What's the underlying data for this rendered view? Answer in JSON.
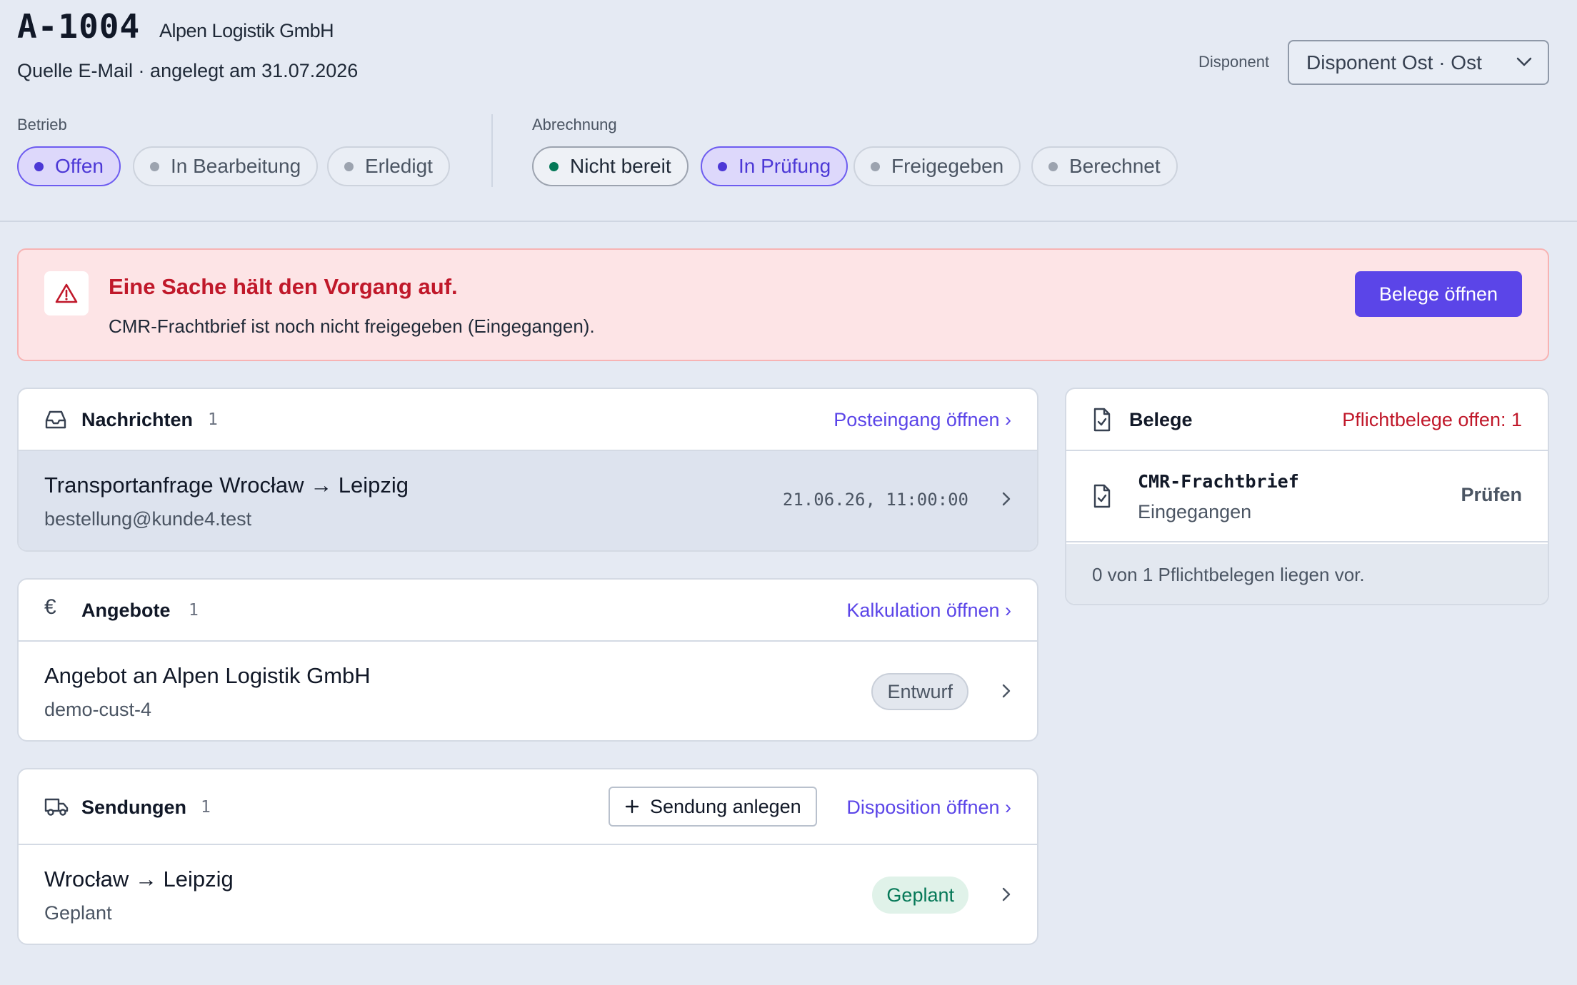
{
  "header": {
    "order_id": "A-1004",
    "customer": "Alpen Logistik GmbH",
    "source_line": "Quelle E-Mail · angelegt am 31.07.2026",
    "disponent_label": "Disponent",
    "disponent_value": "Disponent Ost · Ost"
  },
  "status": {
    "betrieb_label": "Betrieb",
    "betrieb": [
      "Offen",
      "In Bearbeitung",
      "Erledigt"
    ],
    "abrechnung_label": "Abrechnung",
    "abrechnung": [
      "Nicht bereit",
      "In Prüfung",
      "Freigegeben",
      "Berechnet"
    ]
  },
  "alert": {
    "title": "Eine Sache hält den Vorgang auf.",
    "text": "CMR-Frachtbrief ist noch nicht freigegeben (Eingegangen).",
    "button": "Belege öffnen"
  },
  "nachrichten": {
    "title": "Nachrichten",
    "count": "1",
    "link": "Posteingang öffnen ›",
    "item": {
      "subject": "Transportanfrage Wrocław → Leipzig",
      "from": "bestellung@kunde4.test",
      "time": "21.06.26, 11:00:00"
    }
  },
  "angebote": {
    "title": "Angebote",
    "count": "1",
    "link": "Kalkulation öffnen ›",
    "item": {
      "title": "Angebot an Alpen Logistik GmbH",
      "sub": "demo-cust-4",
      "badge": "Entwurf"
    }
  },
  "sendungen": {
    "title": "Sendungen",
    "count": "1",
    "add_button": "Sendung anlegen",
    "link": "Disposition öffnen ›",
    "item": {
      "title": "Wrocław → Leipzig",
      "sub": "Geplant",
      "badge": "Geplant"
    }
  },
  "belege": {
    "title": "Belege",
    "open_info": "Pflichtbelege offen: 1",
    "item": {
      "name": "CMR-Frachtbrief",
      "status": "Eingegangen",
      "action": "Prüfen"
    },
    "footer": "0 von 1 Pflichtbelegen liegen vor."
  },
  "colors": {
    "accent": "#5b45e8",
    "danger": "#c0182a",
    "success": "#047857"
  }
}
